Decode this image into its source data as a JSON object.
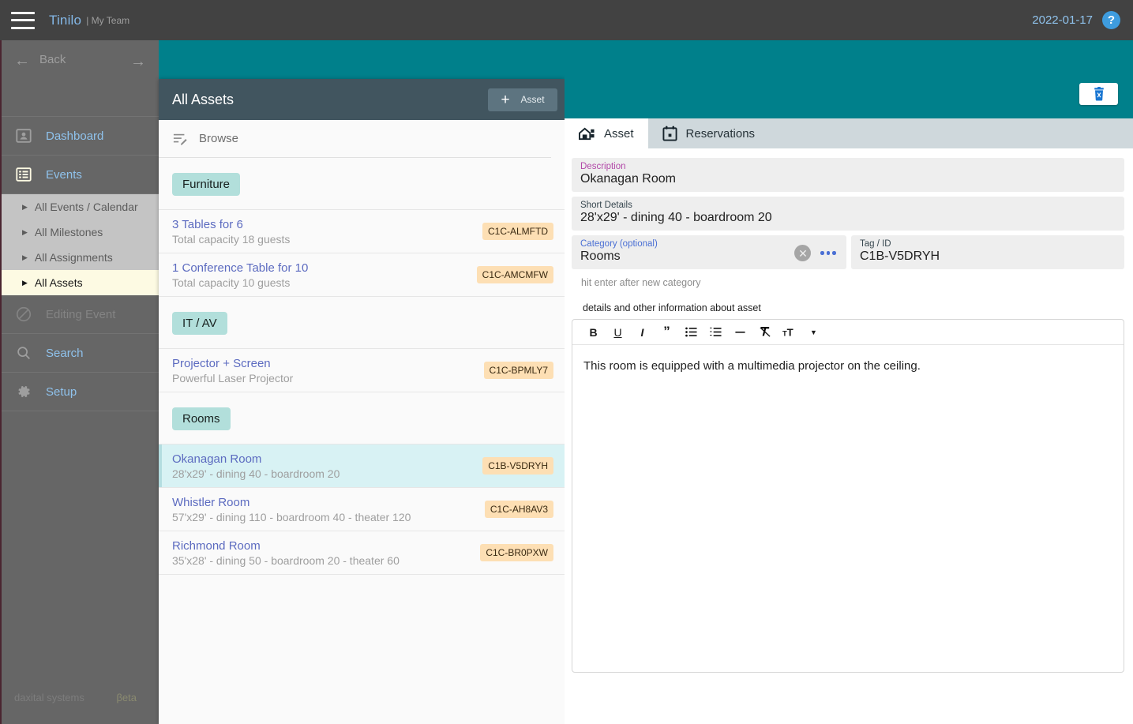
{
  "topbar": {
    "menu_icon": "hamburger-icon",
    "brand": "Tinilo",
    "brand_sub": "| My Team",
    "date": "2022-01-17",
    "help_label": "?"
  },
  "sidebar": {
    "back_label": "Back",
    "items": [
      {
        "label": "Dashboard",
        "icon": "contact-card-icon",
        "state": "enabled"
      },
      {
        "label": "Events",
        "icon": "list-grid-icon",
        "state": "enabled"
      }
    ],
    "sub_items": [
      {
        "label": "All Events / Calendar",
        "active": false
      },
      {
        "label": "All Milestones",
        "active": false
      },
      {
        "label": "All Assignments",
        "active": false
      },
      {
        "label": "All Assets",
        "active": true
      }
    ],
    "items_after": [
      {
        "label": "Editing Event",
        "icon": "no-entry-icon",
        "state": "disabled"
      },
      {
        "label": "Search",
        "icon": "search-icon",
        "state": "enabled"
      },
      {
        "label": "Setup",
        "icon": "gear-icon",
        "state": "enabled"
      }
    ],
    "footer_left": "daxital systems",
    "footer_right": "βeta"
  },
  "list_panel": {
    "title": "All Assets",
    "add_button_label": "Asset",
    "add_button_plus": "+",
    "browse_label": "Browse",
    "groups": [
      {
        "category": "Furniture",
        "assets": [
          {
            "title": "3 Tables for 6",
            "subtitle": "Total capacity 18 guests",
            "tag": "C1C-ALMFTD",
            "selected": false
          },
          {
            "title": "1 Conference Table for 10",
            "subtitle": "Total capacity 10 guests",
            "tag": "C1C-AMCMFW",
            "selected": false
          }
        ]
      },
      {
        "category": "IT / AV",
        "assets": [
          {
            "title": "Projector + Screen",
            "subtitle": "Powerful Laser Projector",
            "tag": "C1C-BPMLY7",
            "selected": false
          }
        ]
      },
      {
        "category": "Rooms",
        "assets": [
          {
            "title": "Okanagan Room",
            "subtitle": "28'x29' - dining 40 - boardroom 20",
            "tag": "C1B-V5DRYH",
            "selected": true
          },
          {
            "title": "Whistler Room",
            "subtitle": "57'x29' - dining 110 - boardroom 40 - theater 120",
            "tag": "C1C-AH8AV3",
            "selected": false
          },
          {
            "title": "Richmond Room",
            "subtitle": "35'x28' - dining 50 - boardroom 20 - theater 60",
            "tag": "C1C-BR0PXW",
            "selected": false
          }
        ]
      }
    ]
  },
  "detail": {
    "delete_button": "delete-asset",
    "tabs": [
      {
        "label": "Asset",
        "icon": "building-icon",
        "active": true
      },
      {
        "label": "Reservations",
        "icon": "calendar-icon",
        "active": false
      }
    ],
    "fields": {
      "description_label": "Description",
      "description_value": "Okanagan Room",
      "short_details_label": "Short Details",
      "short_details_value": "28'x29' - dining 40 - boardroom 20",
      "category_label": "Category (optional)",
      "category_value": "Rooms",
      "tag_label": "Tag / ID",
      "tag_value": "C1B-V5DRYH",
      "category_hint": "hit enter after new category"
    },
    "editor": {
      "label": "details and other information about asset",
      "toolbar": [
        {
          "name": "bold-icon",
          "glyph": "B"
        },
        {
          "name": "underline-icon",
          "glyph": "U"
        },
        {
          "name": "italic-icon",
          "glyph": "I"
        },
        {
          "name": "blockquote-icon",
          "glyph": "”"
        },
        {
          "name": "bullet-list-icon",
          "glyph": "≡"
        },
        {
          "name": "numbered-list-icon",
          "glyph": "≡"
        },
        {
          "name": "horizontal-rule-icon",
          "glyph": "–"
        },
        {
          "name": "clear-format-icon",
          "glyph": "✗"
        },
        {
          "name": "font-size-icon",
          "glyph": "ᴛT"
        },
        {
          "name": "chevron-down-icon",
          "glyph": "▾"
        }
      ],
      "content": "This room is equipped with a multimedia projector on the ceiling."
    }
  },
  "colors": {
    "teal": "#00808b",
    "panel_header": "#41555f",
    "selected_row": "#d8f2f4",
    "chip": "#b2dfdb",
    "tag_badge": "#fddfb4",
    "accent_blue": "#5c6bc0",
    "label_purple": "#b248a8",
    "sidebar_active": "#fdfae3"
  }
}
